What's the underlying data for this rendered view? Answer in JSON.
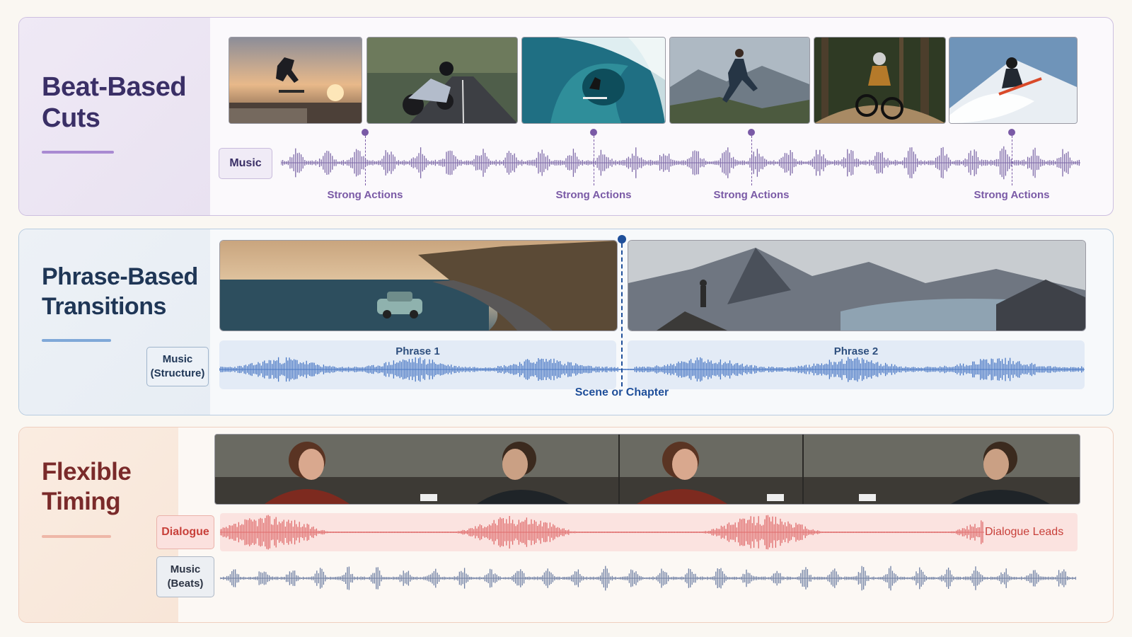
{
  "sections": [
    {
      "title_line1": "Beat-Based",
      "title_line2": "Cuts",
      "track_label": "Music",
      "cue_label": "Strong Actions",
      "cues": [
        "Strong Actions",
        "Strong Actions",
        "Strong Actions",
        "Strong Actions"
      ],
      "accent": "#7a5aa6",
      "clips": [
        "skateboarder-jump-sunset",
        "motorcycle-rider-road",
        "surfer-wave-barrel",
        "trail-runner-mountain",
        "mountain-biker-forest",
        "skier-snow-spray"
      ]
    },
    {
      "title_line1": "Phrase-Based",
      "title_line2": "Transitions",
      "track_label_line1": "Music",
      "track_label_line2": "(Structure)",
      "phrases": [
        "Phrase 1",
        "Phrase 2"
      ],
      "transition_label": "Scene or Chapter",
      "accent": "#1f4f9a",
      "clips": [
        "vintage-car-coastal-road",
        "hiker-mountain-peak-lake"
      ]
    },
    {
      "title_line1": "Flexible",
      "title_line2": "Timing",
      "dialogue_label": "Dialogue",
      "dialogue_note": "Dialogue Leads",
      "music_label_line1": "Music",
      "music_label_line2": "(Beats)",
      "accent": "#c8403a",
      "clips": [
        "woman-cafe-conversation",
        "man-cafe-conversation",
        "woman-cafe-conversation",
        "man-cafe-conversation"
      ]
    }
  ],
  "colors": {
    "beat_wave": "#7e6aa8",
    "phrase_wave": "#4a78c4",
    "dialogue_wave": "#df6b6b",
    "music_beats_wave": "#6f7fa3"
  }
}
